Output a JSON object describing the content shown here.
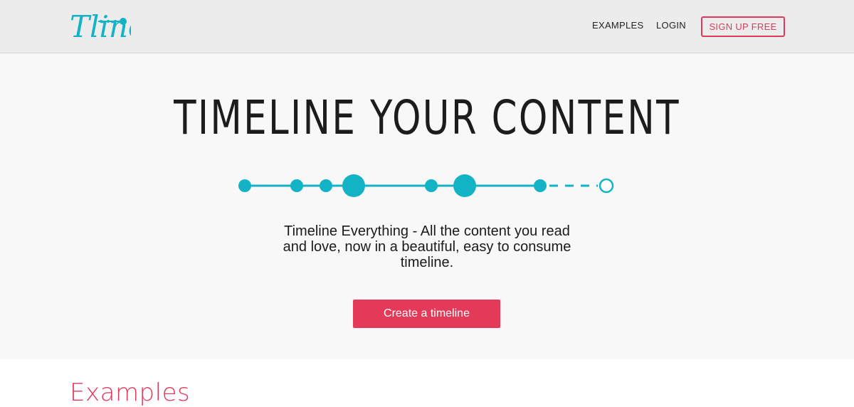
{
  "brand": {
    "logo_text": "Tline",
    "color": "#12b3c4"
  },
  "nav": {
    "examples_label": "EXAMPLES",
    "login_label": "LOGIN",
    "signup_label": "SIGN UP FREE"
  },
  "hero": {
    "title": "TIMELINE YOUR CONTENT",
    "description": "Timeline Everything - All the content you read and love, now in a beautiful, easy to consume timeline.",
    "cta_label": "Create a timeline"
  },
  "examples": {
    "heading": "Examples"
  },
  "colors": {
    "accent": "#e43a5a",
    "teal": "#12b3c4",
    "header_bg": "#ececec",
    "hero_bg": "#f8f8f8"
  }
}
